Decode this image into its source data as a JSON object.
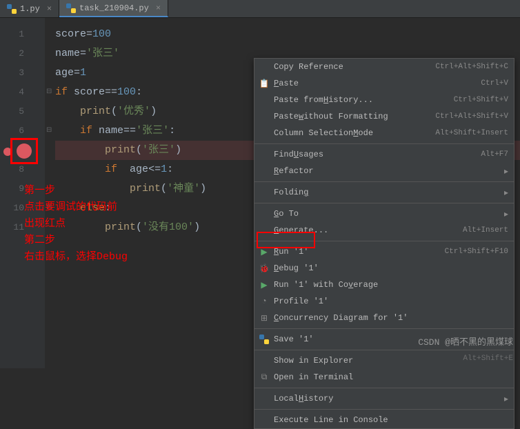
{
  "tabs": {
    "tab1": "1.py",
    "tab2": "task_210904.py"
  },
  "gutter": {
    "lines": [
      "1",
      "2",
      "3",
      "4",
      "5",
      "6",
      "7",
      "8",
      "9",
      "10",
      "11"
    ]
  },
  "code": {
    "l1_a": "score",
    "l1_op": "=",
    "l1_v": "100",
    "l2_a": "name",
    "l2_op": "=",
    "l2_v": "'张三'",
    "l3_a": "age",
    "l3_op": "=",
    "l3_v": "1",
    "l4_kw": "if",
    "l4_a": " score",
    "l4_op": "==",
    "l4_v": "100",
    "l4_c": ":",
    "l5_fn": "print",
    "l5_p": "(",
    "l5_v": "'优秀'",
    "l5_q": ")",
    "l6_kw": "if",
    "l6_a": " name",
    "l6_op": "==",
    "l6_v": "'张三'",
    "l6_c": ":",
    "l7_fn": "print",
    "l7_p": "(",
    "l7_v": "'张三'",
    "l7_q": ")",
    "l8_kw": "if",
    "l8_sp": "  ",
    "l8_a": "age",
    "l8_op": "<=",
    "l8_v": "1",
    "l8_c": ":",
    "l9_fn": "print",
    "l9_p": "(",
    "l9_v": "'神童'",
    "l9_q": ")",
    "l10_kw": "else",
    "l10_c": ":",
    "l11_fn": "print",
    "l11_p": "(",
    "l11_v": "'没有100'",
    "l11_q": ")"
  },
  "annot": {
    "a1": "第一步",
    "a2": "点击要调试的代码前",
    "a3": "出现红点",
    "a4": "第二步",
    "a5": "右击鼠标，选择Debug"
  },
  "menu": {
    "copy_ref": "Copy Reference",
    "copy_ref_sc": "Ctrl+Alt+Shift+C",
    "paste": "aste",
    "paste_p": "P",
    "paste_sc": "Ctrl+V",
    "paste_hist": "Paste from ",
    "paste_hist_h": "H",
    "paste_hist_t": "istory...",
    "paste_hist_sc": "Ctrl+Shift+V",
    "paste_wf": "Paste ",
    "paste_wf_w": "w",
    "paste_wf_t": "ithout Formatting",
    "paste_wf_sc": "Ctrl+Alt+Shift+V",
    "col_sel": "Column Selection ",
    "col_sel_m": "M",
    "col_sel_t": "ode",
    "col_sel_sc": "Alt+Shift+Insert",
    "find_u": "Find ",
    "find_u_u": "U",
    "find_u_t": "sages",
    "find_u_sc": "Alt+F7",
    "refactor": "efactor",
    "refactor_r": "R",
    "folding": "Foldin",
    "folding_g": "g",
    "goto": "o To",
    "goto_g": "G",
    "generate": "enerate...",
    "generate_g": "G",
    "generate_sc": "Alt+Insert",
    "run": "un '1'",
    "run_r": "R",
    "run_sc": "Ctrl+Shift+F10",
    "debug": "ebug '1'",
    "debug_d": "D",
    "run_cov": "Run '1' with Co",
    "run_cov_v": "v",
    "run_cov_t": "erage",
    "profile": "Profile '1'",
    "conc": "oncurrency Diagram for '1'",
    "conc_c": "C",
    "save": "Save '1'",
    "show_exp": "Show in Explorer",
    "open_term": "Open in Terminal",
    "local_hist": "Local ",
    "local_hist_h": "H",
    "local_hist_t": "istory",
    "exec_line": "Execute Line in Console"
  },
  "watermark": "CSDN @晒不黑的黑煤球",
  "watermark2": "Alt+Shift+E",
  "chart_data": null
}
